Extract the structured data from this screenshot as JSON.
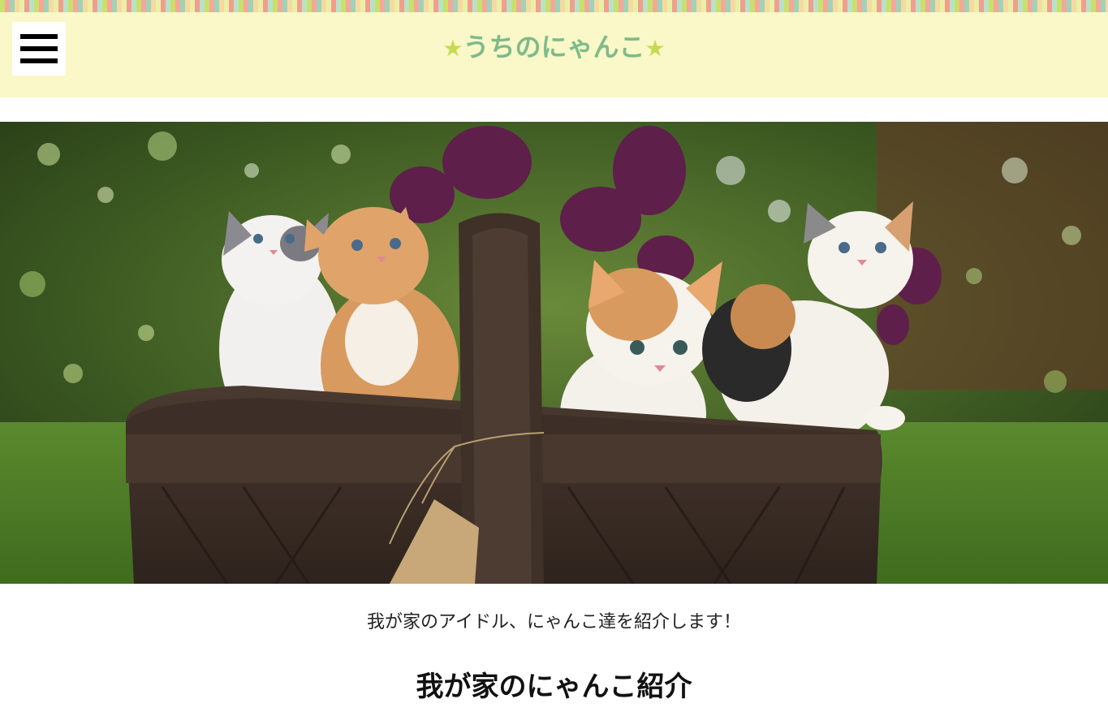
{
  "header": {
    "menu_icon": "hamburger-menu-icon",
    "star_left": "★",
    "title": "うちのにゃんこ",
    "star_right": "★",
    "stripe_colors": [
      "#c9e06a",
      "#f4a89a",
      "#9fd3b8",
      "#f7d9a0",
      "#e8f0a8"
    ],
    "background_color": "#faf7c8",
    "title_color": "#7dbb8a",
    "star_color": "#c4dc50"
  },
  "hero": {
    "image": "kittens-in-basket-photo"
  },
  "main": {
    "intro_text": "我が家のアイドル、にゃんこ達を紹介します！",
    "section_title": "我が家のにゃんこ紹介"
  }
}
